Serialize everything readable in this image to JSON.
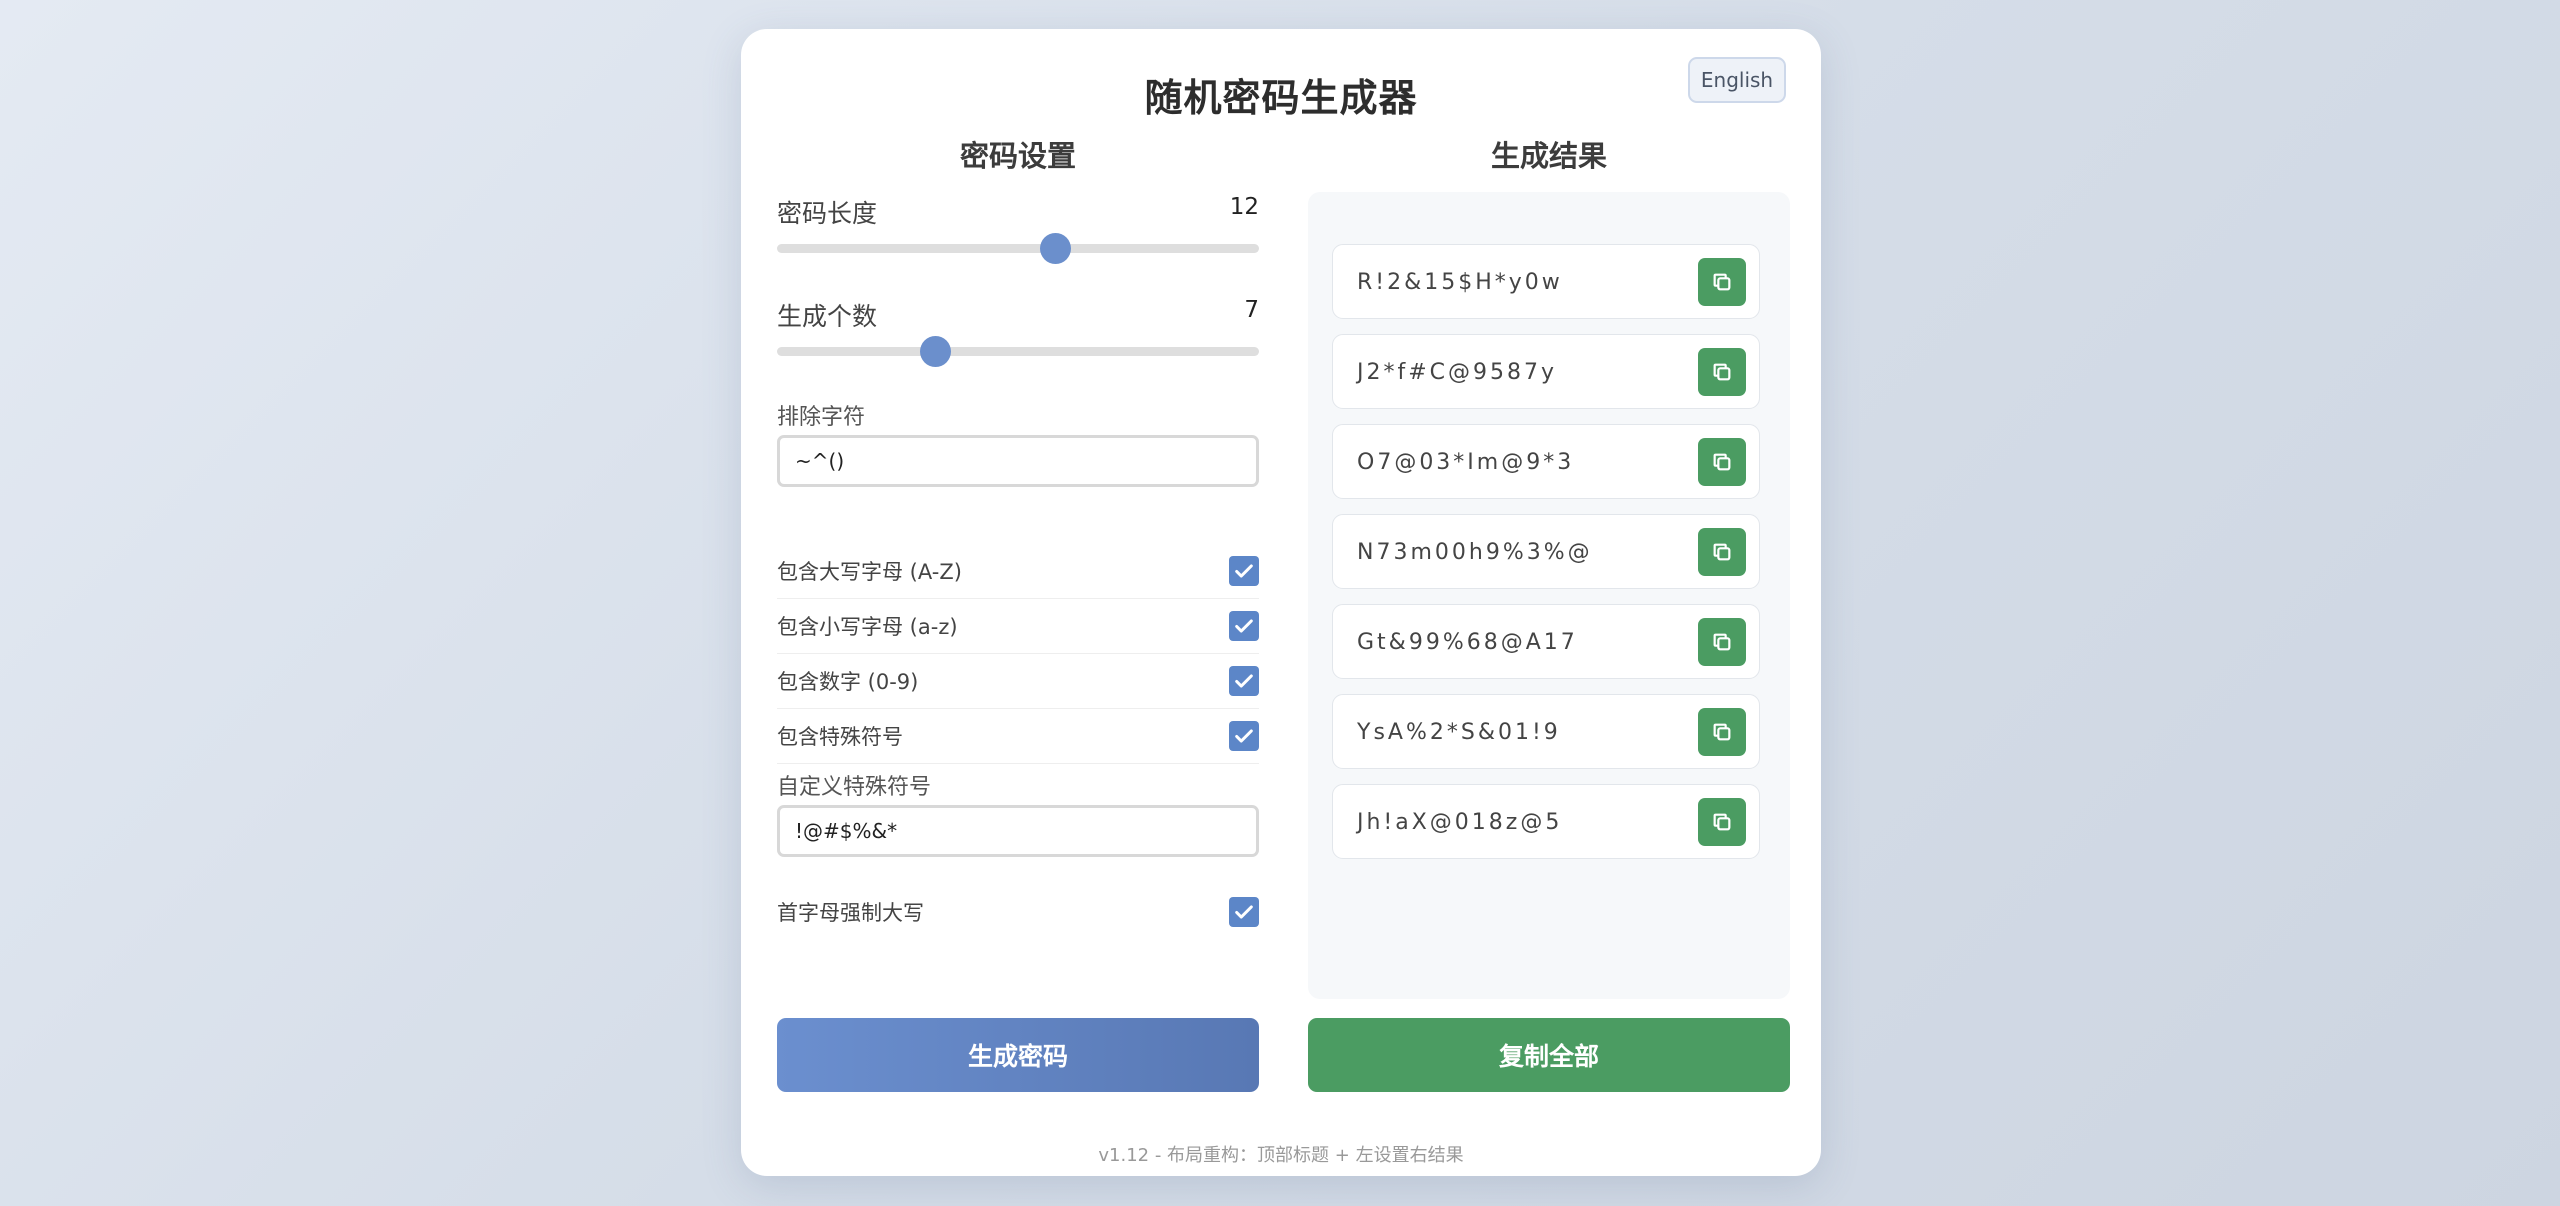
{
  "app": {
    "title": "随机密码生成器",
    "language_button": "English"
  },
  "settings": {
    "section_title": "密码设置",
    "length": {
      "label": "密码长度",
      "value": "12",
      "fraction": 0.576
    },
    "count": {
      "label": "生成个数",
      "value": "7",
      "fraction": 0.327
    },
    "exclude": {
      "label": "排除字符",
      "value": "~^()"
    },
    "options": [
      {
        "label": "包含大写字母 (A-Z)",
        "checked": true
      },
      {
        "label": "包含小写字母 (a-z)",
        "checked": true
      },
      {
        "label": "包含数字 (0-9)",
        "checked": true
      },
      {
        "label": "包含特殊符号",
        "checked": true
      }
    ],
    "custom_symbols": {
      "label": "自定义特殊符号",
      "value": "!@#$%&*"
    },
    "force_upper": {
      "label": "首字母强制大写",
      "checked": true
    }
  },
  "results": {
    "section_title": "生成结果",
    "passwords": [
      "R!2&15$H*y0w",
      "J2*f#C@9587y",
      "O7@03*Im@9*3",
      "N73m00h9%3%@",
      "Gt&99%68@A17",
      "YsA%2*S&01!9",
      "Jh!aX@018z@5"
    ]
  },
  "actions": {
    "generate": "生成密码",
    "copy_all": "复制全部"
  },
  "footer": "v1.12 - 布局重构：顶部标题 + 左设置右结果",
  "colors": {
    "accent": "#6b8fcc",
    "green": "#4b9c62"
  }
}
